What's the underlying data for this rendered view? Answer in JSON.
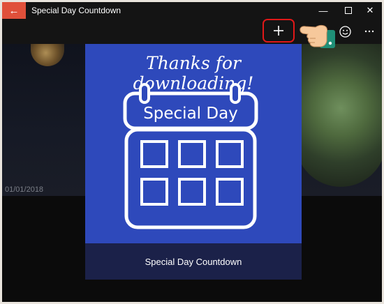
{
  "titlebar": {
    "back_icon": "arrow-left-icon",
    "title": "Special Day Countdown",
    "controls": [
      "minimize-icon",
      "maximize-icon",
      "close-icon"
    ]
  },
  "toolbar": {
    "add_icon": "plus-icon",
    "emoji_icon": "smiley-icon",
    "more_icon": "more-icon",
    "highlight_color": "#e01818"
  },
  "hero": {
    "date": "01/01/2018",
    "next_icon": "chevron-right-icon"
  },
  "dialog": {
    "heading": "Thanks for downloading!",
    "calendar_label": "Special Day",
    "footer_text": "Special Day Countdown",
    "background_color": "#2e49bb",
    "footer_color": "#1b2149"
  },
  "colors": {
    "accent": "#e0503a"
  }
}
